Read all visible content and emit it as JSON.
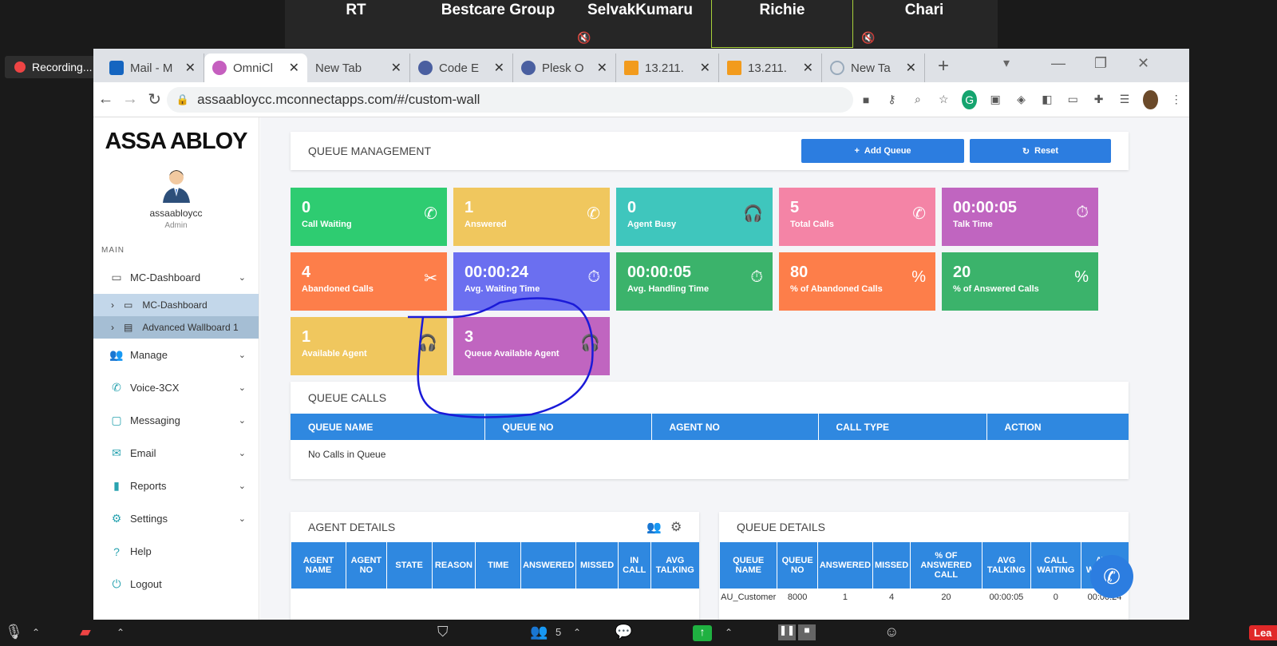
{
  "zoom": {
    "participants": [
      {
        "name": "RT",
        "muted": false
      },
      {
        "name": "Bestcare Group",
        "muted": false
      },
      {
        "name": "SelvakKumaru",
        "muted": true
      },
      {
        "name": "Richie",
        "muted": false
      },
      {
        "name": "Chari",
        "muted": true
      }
    ],
    "recording_label": "Recording...",
    "bottom": {
      "participants_count": "5",
      "leave_label": "Lea"
    }
  },
  "browser": {
    "tabs": [
      {
        "label": "Mail - M",
        "active": false
      },
      {
        "label": "OmniCl",
        "active": true
      },
      {
        "label": "New Tab",
        "active": false
      },
      {
        "label": "Code E",
        "active": false
      },
      {
        "label": "Plesk O",
        "active": false
      },
      {
        "label": "13.211.",
        "active": false
      },
      {
        "label": "13.211.",
        "active": false
      },
      {
        "label": "New Ta",
        "active": false
      }
    ],
    "url": "assaabloycc.mconnectapps.com/#/custom-wall"
  },
  "sidebar": {
    "logo": "ASSA ABLOY",
    "username": "assaabloycc",
    "role": "Admin",
    "section_label": "MAIN",
    "items": [
      {
        "label": "MC-Dashboard",
        "icon": "monitor-icon"
      },
      {
        "label": "Manage",
        "icon": "users-icon"
      },
      {
        "label": "Voice-3CX",
        "icon": "phone-icon"
      },
      {
        "label": "Messaging",
        "icon": "chat-icon"
      },
      {
        "label": "Email",
        "icon": "email-icon"
      },
      {
        "label": "Reports",
        "icon": "report-icon"
      },
      {
        "label": "Settings",
        "icon": "gear-icon"
      },
      {
        "label": "Help",
        "icon": "help-icon"
      },
      {
        "label": "Logout",
        "icon": "logout-icon"
      }
    ],
    "subitems": [
      {
        "label": "MC-Dashboard"
      },
      {
        "label": "Advanced Wallboard 1"
      }
    ]
  },
  "queue_management": {
    "title": "QUEUE MANAGEMENT",
    "add_label": "Add Queue",
    "reset_label": "Reset"
  },
  "tiles": [
    {
      "value": "0",
      "label": "Call Waiting",
      "color": "#2ecc71"
    },
    {
      "value": "1",
      "label": "Answered",
      "color": "#f0c75e"
    },
    {
      "value": "0",
      "label": "Agent Busy",
      "color": "#3fc6bd"
    },
    {
      "value": "5",
      "label": "Total Calls",
      "color": "#f484a6"
    },
    {
      "value": "00:00:05",
      "label": "Talk Time",
      "color": "#c065c0"
    },
    {
      "value": "4",
      "label": "Abandoned Calls",
      "color": "#fd7e4a"
    },
    {
      "value": "00:00:24",
      "label": "Avg. Waiting Time",
      "color": "#6b6ff0"
    },
    {
      "value": "00:00:05",
      "label": "Avg. Handling Time",
      "color": "#3bb36b"
    },
    {
      "value": "80",
      "label": "% of Abandoned Calls",
      "color": "#fd7e4a"
    },
    {
      "value": "20",
      "label": "% of Answered Calls",
      "color": "#3bb36b"
    },
    {
      "value": "1",
      "label": "Available Agent",
      "color": "#f0c75e"
    },
    {
      "value": "3",
      "label": "Queue Available Agent",
      "color": "#c065c0"
    }
  ],
  "queue_calls": {
    "title": "QUEUE CALLS",
    "columns": [
      "QUEUE NAME",
      "QUEUE NO",
      "AGENT NO",
      "CALL TYPE",
      "ACTION"
    ],
    "empty_text": "No Calls in Queue"
  },
  "agent_details": {
    "title": "AGENT DETAILS",
    "columns": [
      "AGENT NAME",
      "AGENT NO",
      "STATE",
      "REASON",
      "TIME",
      "ANSWERED",
      "MISSED",
      "IN CALL",
      "AVG TALKING"
    ]
  },
  "queue_details": {
    "title": "QUEUE DETAILS",
    "columns": [
      "QUEUE NAME",
      "QUEUE NO",
      "ANSWERED",
      "MISSED",
      "% OF ANSWERED CALL",
      "AVG TALKING",
      "CALL WAITING",
      "AVG WAITING"
    ],
    "rows": [
      [
        "AU_Customer",
        "8000",
        "1",
        "4",
        "20",
        "00:00:05",
        "0",
        "00:00:24"
      ]
    ]
  }
}
